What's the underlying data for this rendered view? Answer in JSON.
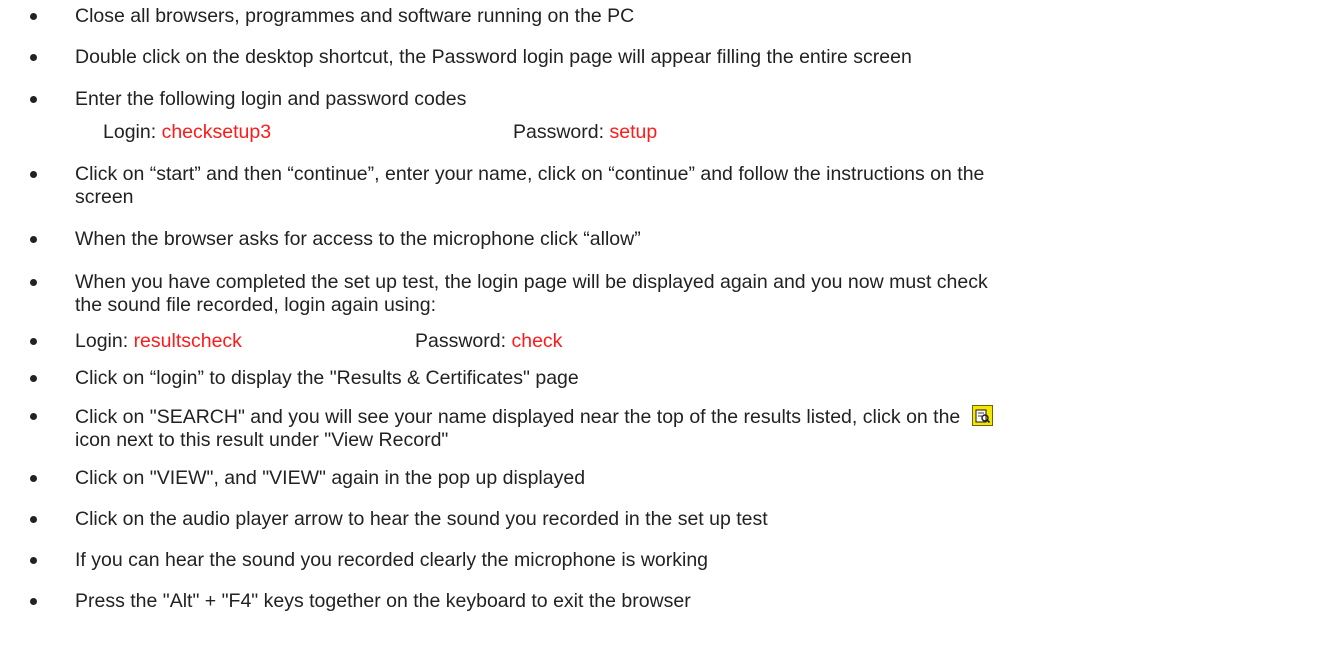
{
  "instructions": [
    {
      "text": "Close all browsers, programmes and software running on the PC"
    },
    {
      "text": "Double click on the desktop shortcut, the Password login page will appear filling the entire screen"
    },
    {
      "text": "Enter the following login and password codes"
    },
    {
      "text": "Click on “start” and then “continue”, enter your name, click on “continue” and follow the instructions on the",
      "text2": "screen"
    },
    {
      "text": "When the browser asks for access to the microphone click “allow”"
    },
    {
      "text": "When you have completed the set up test, the login page will be displayed again and you now must check",
      "text2": "the sound file recorded, login again using:"
    },
    {
      "text": "Click on “login” to display the \"Results & Certificates\" page"
    },
    {
      "text": "Click on \"SEARCH\" and you will see your name displayed near the top of the results listed, click on the",
      "text2": "icon next to this result under \"View Record\""
    },
    {
      "text": "Click on \"VIEW\", and \"VIEW\" again in the pop up displayed"
    },
    {
      "text": "Click on the audio player arrow to hear the sound you recorded in the set up test"
    },
    {
      "text": "If you can hear the sound you recorded clearly the microphone is working"
    },
    {
      "text": "Press the \"Alt\" + \"F4\" keys together on the keyboard to exit the browser"
    }
  ],
  "setup_credentials": {
    "login_label": "Login:",
    "login_value": "checksetup3",
    "password_label": "Password:",
    "password_value": "setup"
  },
  "results_credentials": {
    "login_label": "Login:",
    "login_value": "resultscheck",
    "password_label": "Password:",
    "password_value": "check"
  },
  "colors": {
    "text": "#222222",
    "credential_value": "#ff1a1a",
    "view_record_icon": "#f3e600"
  },
  "icons": {
    "bullet": "bullet-dot",
    "view_record": "view-record-icon"
  }
}
